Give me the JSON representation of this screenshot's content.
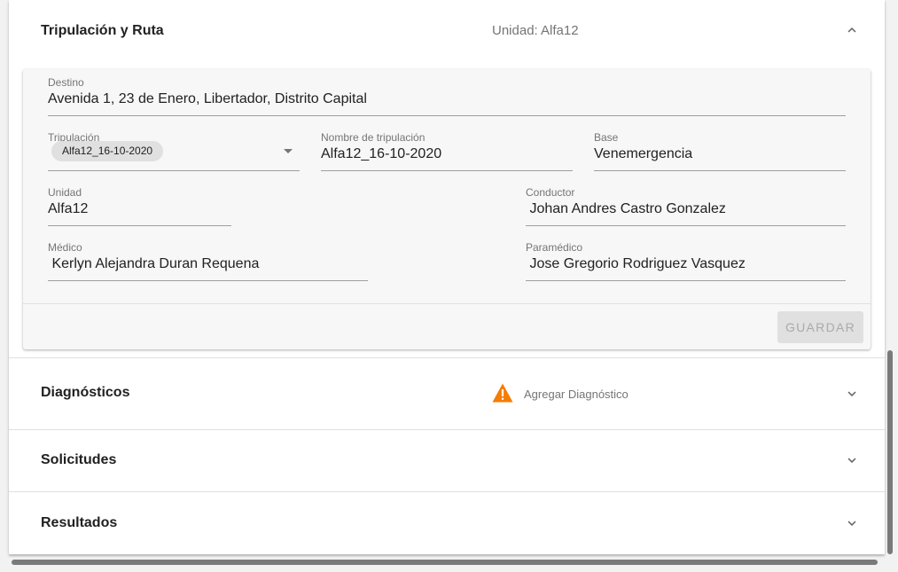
{
  "crew_panel": {
    "title": "Tripulación y Ruta",
    "unit_summary": "Unidad: Alfa12",
    "fields": {
      "destino": {
        "label": "Destino",
        "value": "Avenida 1, 23 de Enero, Libertador, Distrito Capital"
      },
      "tripulacion": {
        "label": "Tripulación",
        "chip": "Alfa12_16-10-2020"
      },
      "nombre_tripulacion": {
        "label": "Nombre de tripulación",
        "value": "Alfa12_16-10-2020"
      },
      "base": {
        "label": "Base",
        "value": "Venemergencia"
      },
      "unidad": {
        "label": "Unidad",
        "value": "Alfa12"
      },
      "conductor": {
        "label": "Conductor",
        "value": " Johan Andres Castro Gonzalez"
      },
      "medico": {
        "label": "Médico",
        "value": " Kerlyn Alejandra Duran Requena"
      },
      "paramedico": {
        "label": "Paramédico",
        "value": " Jose Gregorio Rodriguez Vasquez"
      }
    },
    "save_label": "GUARDAR"
  },
  "diagnosticos_panel": {
    "title": "Diagnósticos",
    "warning_icon": "warning-icon",
    "warning_color": "#f57c00",
    "description": "Agregar Diagnóstico"
  },
  "solicitudes_panel": {
    "title": "Solicitudes"
  },
  "resultados_panel": {
    "title": "Resultados"
  },
  "colors": {
    "card_background": "#f7f7f7",
    "disabled_button": "#e0e0e0",
    "muted_text": "#757575"
  }
}
